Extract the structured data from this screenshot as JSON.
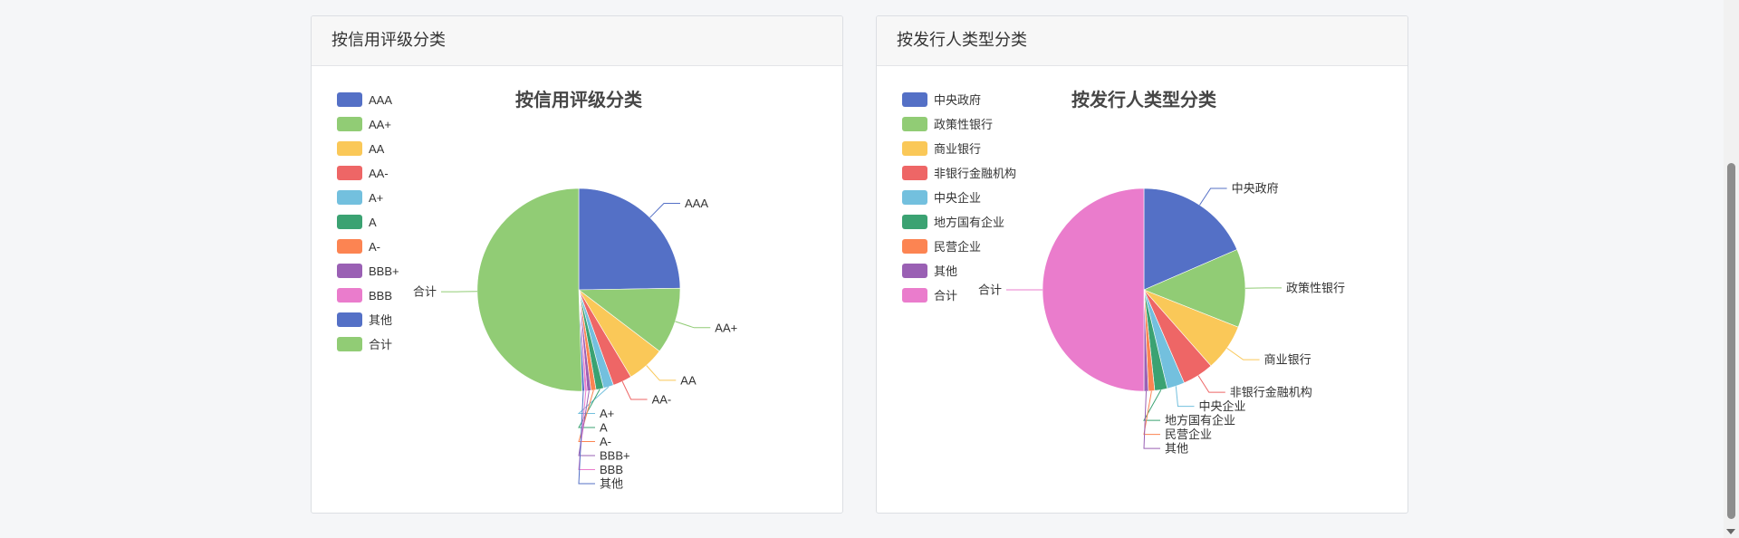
{
  "panels": [
    {
      "header": "按信用评级分类"
    },
    {
      "header": "按发行人类型分类"
    }
  ],
  "chart_data": [
    {
      "type": "pie",
      "title": "按信用评级分类",
      "legend_position": "top-left",
      "categories": [
        "AAA",
        "AA+",
        "AA",
        "AA-",
        "A+",
        "A",
        "A-",
        "BBB+",
        "BBB",
        "其他",
        "合计"
      ],
      "values": [
        24.5,
        10.5,
        6.0,
        3.0,
        1.6,
        1.2,
        0.8,
        0.6,
        0.4,
        0.4,
        50.0
      ],
      "colors": [
        "#5470c6",
        "#91cc75",
        "#fac858",
        "#ee6666",
        "#73c0de",
        "#3ba272",
        "#fc8452",
        "#9a60b4",
        "#ea7ccc",
        "#5470c6",
        "#91cc75"
      ]
    },
    {
      "type": "pie",
      "title": "按发行人类型分类",
      "legend_position": "top-left",
      "categories": [
        "中央政府",
        "政策性银行",
        "商业银行",
        "非银行金融机构",
        "中央企业",
        "地方国有企业",
        "民营企业",
        "其他",
        "合计"
      ],
      "values": [
        18.5,
        12.5,
        7.5,
        5.0,
        2.8,
        2.0,
        1.0,
        0.7,
        50.0
      ],
      "colors": [
        "#5470c6",
        "#91cc75",
        "#fac858",
        "#ee6666",
        "#73c0de",
        "#3ba272",
        "#fc8452",
        "#9a60b4",
        "#ea7ccc"
      ]
    }
  ]
}
